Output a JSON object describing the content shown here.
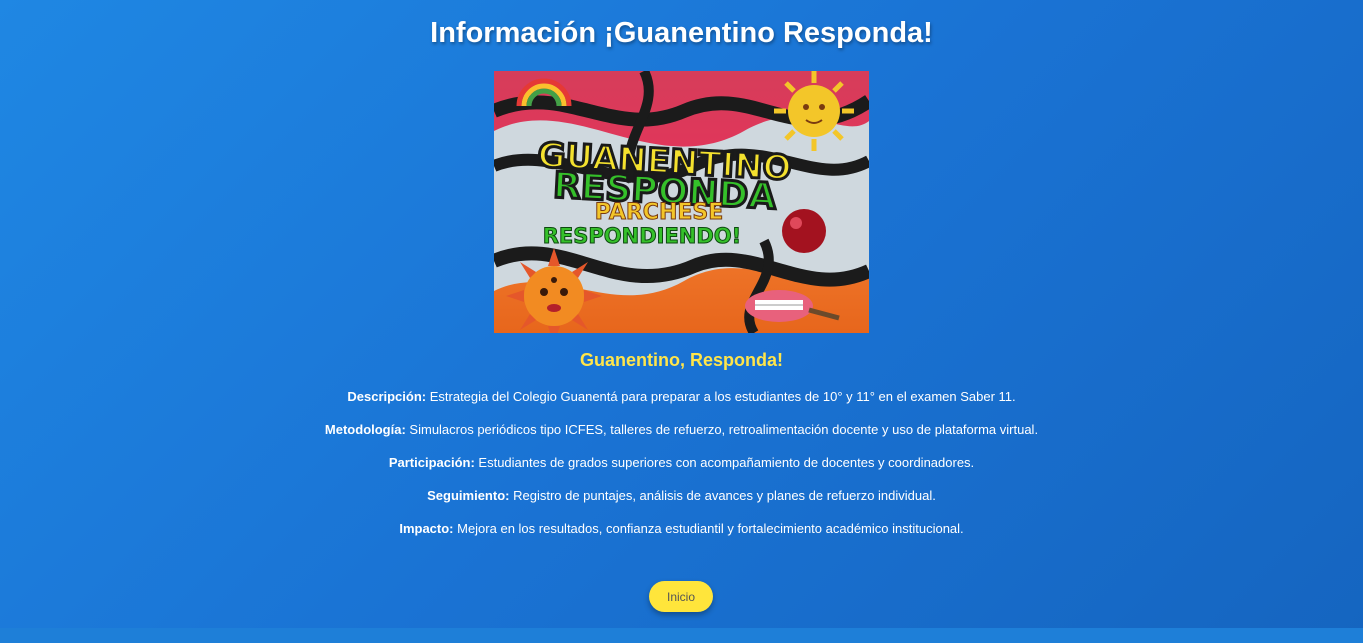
{
  "page": {
    "title": "Información ¡Guanentino Responda!"
  },
  "poster": {
    "line1": "GUANENTINO",
    "line2": "RESPONDA",
    "line3": "PARCHESE",
    "line4": "RESPONDIENDO!"
  },
  "program": {
    "name": "Guanentino, Responda!",
    "details": [
      {
        "label": "Descripción:",
        "text": " Estrategia del Colegio Guanentá para preparar a los estudiantes de 10° y 11° en el examen Saber 11."
      },
      {
        "label": "Metodología:",
        "text": " Simulacros periódicos tipo ICFES, talleres de refuerzo, retroalimentación docente y uso de plataforma virtual."
      },
      {
        "label": "Participación:",
        "text": " Estudiantes de grados superiores con acompañamiento de docentes y coordinadores."
      },
      {
        "label": "Seguimiento:",
        "text": " Registro de puntajes, análisis de avances y planes de refuerzo individual."
      },
      {
        "label": "Impacto:",
        "text": " Mejora en los resultados, confianza estudiantil y fortalecimiento académico institucional."
      }
    ]
  },
  "nav": {
    "home_label": "Inicio"
  },
  "colors": {
    "background": "#1a73d4",
    "accent_yellow": "#ffe54a",
    "text": "#ffffff"
  }
}
